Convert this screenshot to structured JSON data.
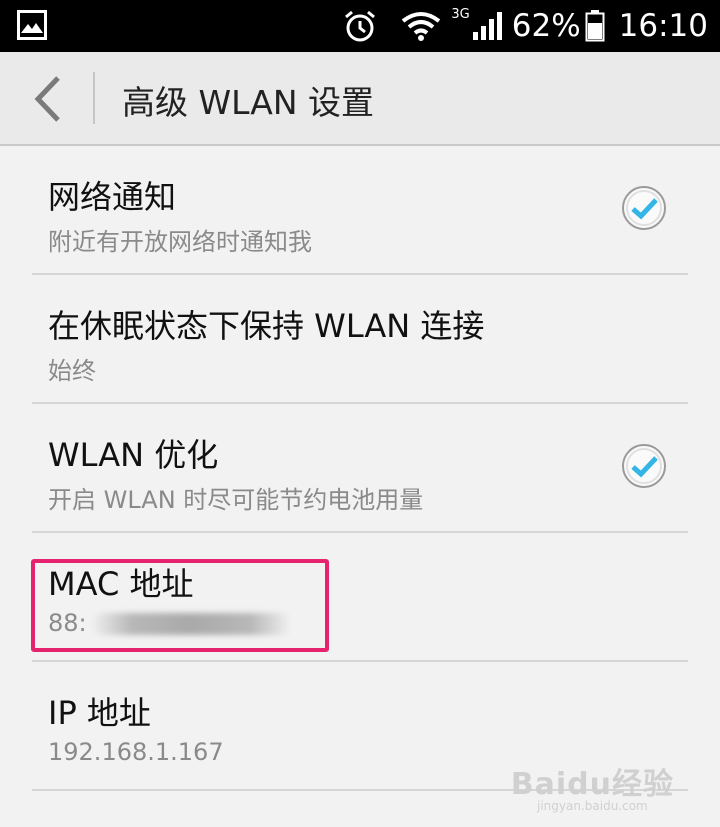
{
  "status_bar": {
    "icons": [
      "image-icon",
      "alarm-icon",
      "wifi-icon",
      "signal-icon",
      "battery-icon"
    ],
    "network_type": "3G",
    "battery": "62%",
    "time": "16:10"
  },
  "action_bar": {
    "title": "高级 WLAN 设置"
  },
  "items": [
    {
      "title": "网络通知",
      "subtitle": "附近有开放网络时通知我",
      "checked": true
    },
    {
      "title": "在休眠状态下保持 WLAN 连接",
      "subtitle": "始终"
    },
    {
      "title": "WLAN 优化",
      "subtitle": "开启 WLAN 时尽可能节约电池用量",
      "checked": true
    },
    {
      "title": "MAC 地址",
      "subtitle": "88:"
    },
    {
      "title": "IP 地址",
      "subtitle": "192.168.1.167"
    }
  ],
  "colors": {
    "accent": "#33b5e5",
    "highlight": "#e5236f"
  },
  "watermark": {
    "main": "Baidu经验",
    "sub": "jingyan.baidu.com"
  }
}
